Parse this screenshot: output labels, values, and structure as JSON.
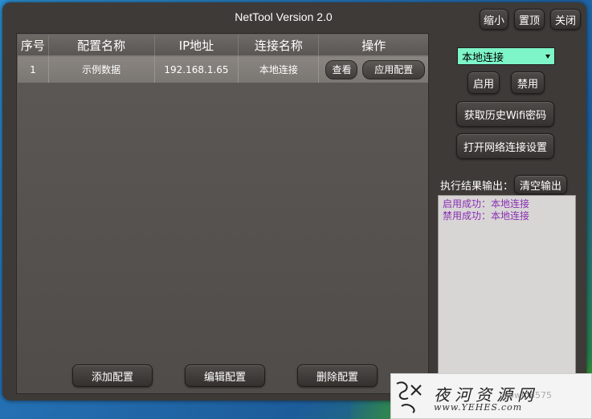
{
  "window": {
    "title": "NetTool Version 2.0",
    "buttons": {
      "minimize": "缩小",
      "pin": "置顶",
      "close": "关闭"
    }
  },
  "table": {
    "headers": [
      "序号",
      "配置名称",
      "IP地址",
      "连接名称",
      "操作"
    ],
    "rows": [
      {
        "index": "1",
        "config_name": "示例数据",
        "ip": "192.168.1.65",
        "connection": "本地连接",
        "view_label": "查看",
        "apply_label": "应用配置"
      }
    ]
  },
  "bottom_buttons": {
    "add": "添加配置",
    "edit": "编辑配置",
    "delete": "删除配置"
  },
  "side": {
    "connection_select": "本地连接",
    "enable": "启用",
    "disable": "禁用",
    "wifi_history": "获取历史Wifi密码",
    "open_network": "打开网络连接设置",
    "output_label": "执行结果输出：",
    "clear_output": "清空输出",
    "output_lines": [
      "启用成功：本地连接",
      "禁用成功：本地连接"
    ]
  },
  "watermark": {
    "text": "夜河资源网",
    "url": "www.YEHES.com",
    "faded": "@bwip6575"
  },
  "colors": {
    "select_bg": "#7ef5c8",
    "output_text": "#8a2fb5"
  }
}
